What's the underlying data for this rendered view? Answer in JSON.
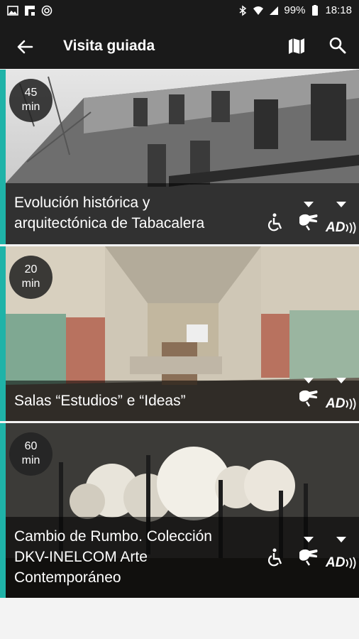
{
  "status_bar": {
    "battery": "99%",
    "time": "18:18",
    "icons": [
      "image-icon",
      "flipboard-icon",
      "sync-icon",
      "bluetooth-icon",
      "wifi-icon",
      "signal-icon",
      "battery-icon"
    ]
  },
  "app_bar": {
    "title": "Visita guiada",
    "back_icon": "arrow-left-icon",
    "map_icon": "map-icon",
    "search_icon": "search-icon"
  },
  "colors": {
    "accent": "#1fb3a8",
    "bar": "#1a1a1a"
  },
  "tours": [
    {
      "duration_value": "45",
      "duration_unit": "min",
      "title_line1": "Evolución histórica y",
      "title_line2": "arquitectónica de Tabacalera",
      "accessibility": [
        "wheelchair-icon",
        "sign-language-icon",
        "audio-description-icon"
      ],
      "accessibility_text": "AD"
    },
    {
      "duration_value": "20",
      "duration_unit": "min",
      "title_line1": "Salas “Estudios” e “Ideas”",
      "accessibility": [
        "sign-language-icon",
        "audio-description-icon"
      ],
      "accessibility_text": "AD"
    },
    {
      "duration_value": "60",
      "duration_unit": "min",
      "title_line1": "Cambio de Rumbo. Colección",
      "title_line2": "DKV-INELCOM Arte",
      "title_line3": "Contemporáneo",
      "accessibility": [
        "wheelchair-icon",
        "sign-language-icon",
        "audio-description-icon"
      ],
      "accessibility_text": "AD"
    }
  ]
}
